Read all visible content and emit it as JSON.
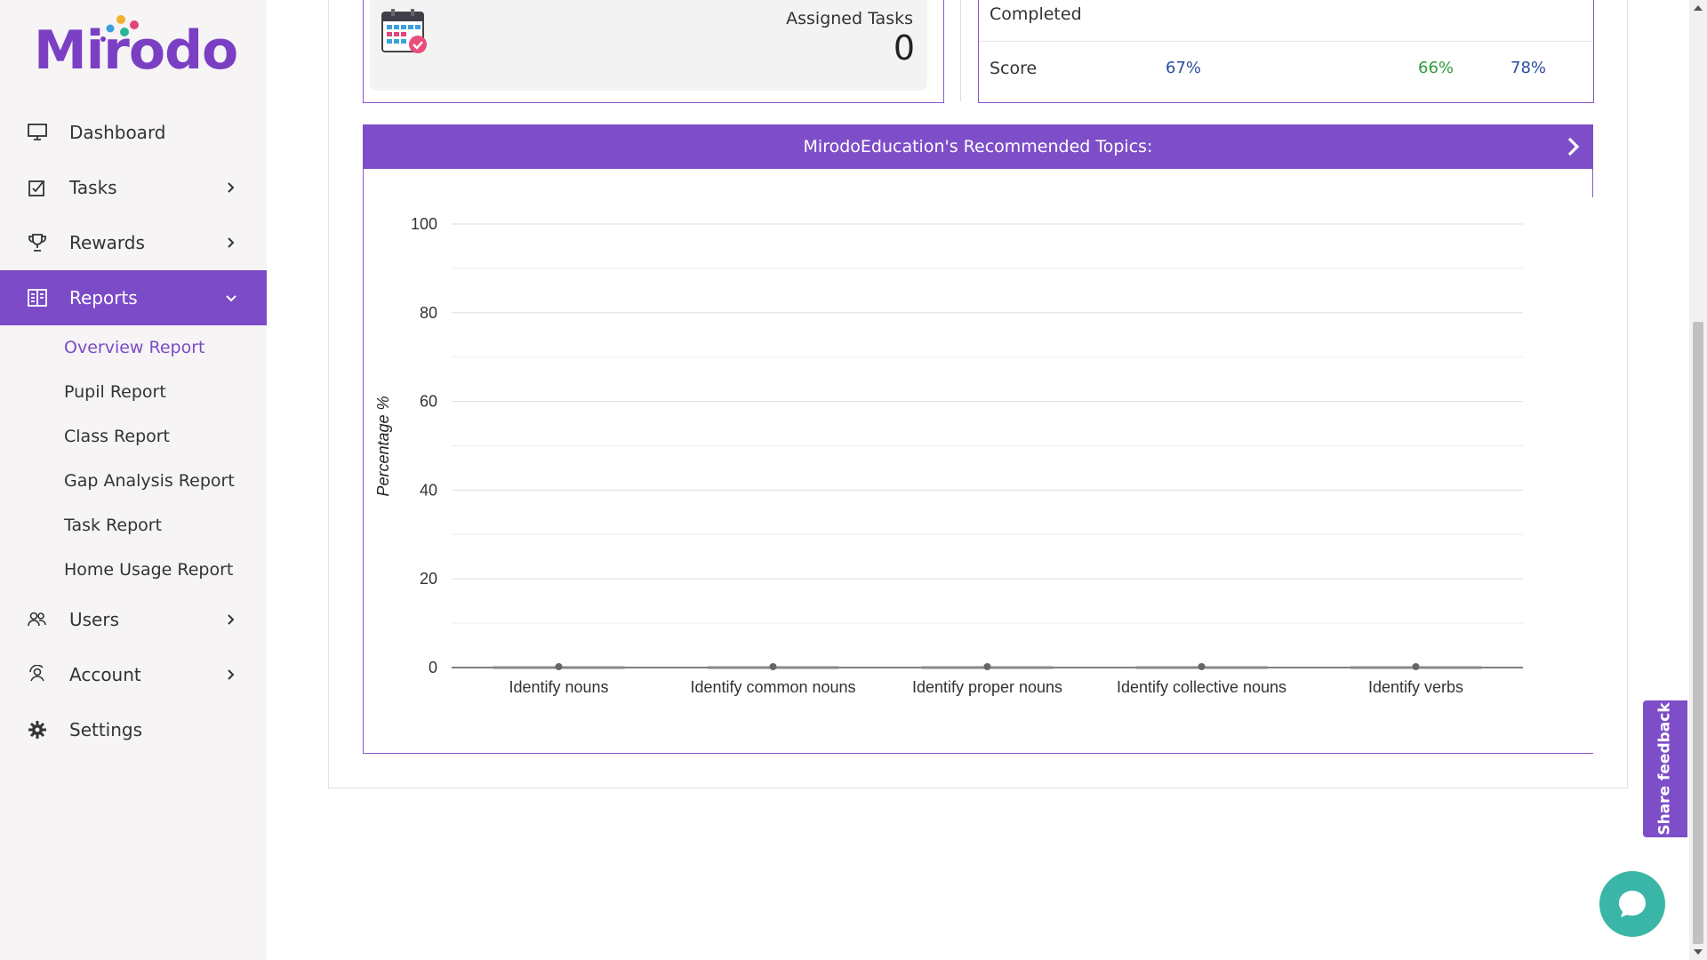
{
  "logo": {
    "text": "Mirodo"
  },
  "sidebar": {
    "items": [
      {
        "label": "Dashboard",
        "icon": "monitor-icon"
      },
      {
        "label": "Tasks",
        "icon": "tasks-icon"
      },
      {
        "label": "Rewards",
        "icon": "trophy-icon"
      },
      {
        "label": "Reports",
        "icon": "reports-icon"
      },
      {
        "label": "Users",
        "icon": "users-icon"
      },
      {
        "label": "Account",
        "icon": "account-icon"
      },
      {
        "label": "Settings",
        "icon": "gear-icon"
      }
    ],
    "reports_sub": [
      "Overview Report",
      "Pupil Report",
      "Class Report",
      "Gap Analysis Report",
      "Task Report",
      "Home Usage Report"
    ]
  },
  "assigned": {
    "label": "Assigned Tasks",
    "value": "0"
  },
  "stats": {
    "completed_label": "Completed",
    "score_label": "Score",
    "scores": [
      "67%",
      "66%",
      "78%"
    ],
    "score_colors": [
      "#2a4da0",
      "#2e9a3c",
      "#2a4da0"
    ]
  },
  "recommended": {
    "title": "MirodoEducation's Recommended Topics:"
  },
  "chart_data": {
    "type": "line",
    "categories": [
      "Identify nouns",
      "Identify common nouns",
      "Identify proper nouns",
      "Identify collective nouns",
      "Identify verbs"
    ],
    "series": [
      {
        "values": [
          0,
          0,
          0,
          0,
          0
        ]
      }
    ],
    "ylabel": "Percentage %",
    "ylim": [
      0,
      100
    ],
    "yticks": [
      0,
      20,
      40,
      60,
      80,
      100
    ],
    "grid": true
  },
  "feedback": {
    "label": "Share feedback"
  },
  "colors": {
    "brand": "#7e4ec8",
    "sidebar_bg": "#f6f4f5",
    "chat": "#3ab6a8"
  }
}
